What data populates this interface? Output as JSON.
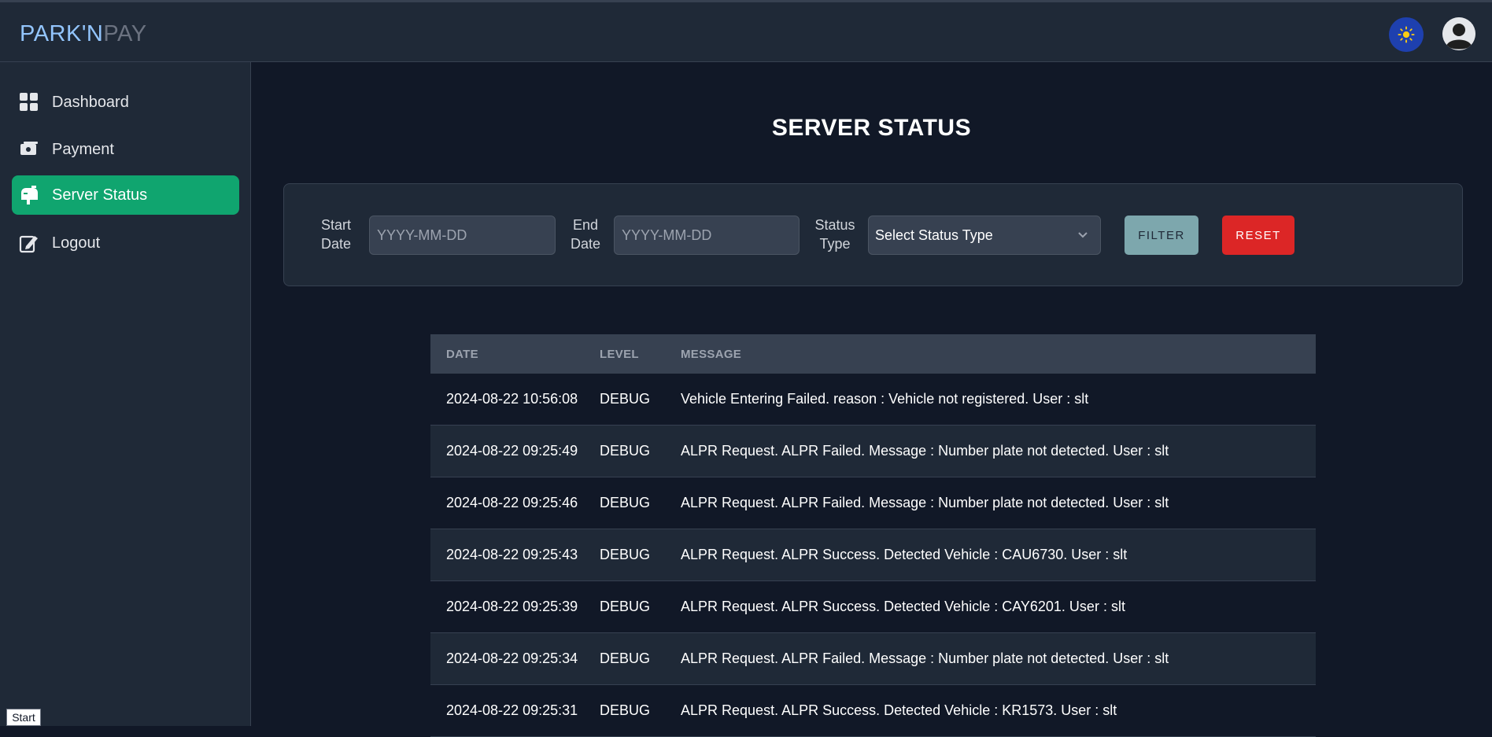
{
  "app": {
    "brand_part1": "PARK'N",
    "brand_part2": "PAY"
  },
  "header": {
    "theme_icon": "sun-icon",
    "avatar_icon": "user-avatar-icon"
  },
  "sidebar": {
    "items": [
      {
        "label": "Dashboard",
        "icon": "dashboard-grid-icon",
        "active": false
      },
      {
        "label": "Payment",
        "icon": "payment-icon",
        "active": false
      },
      {
        "label": "Server Status",
        "icon": "mailbox-icon",
        "active": true
      },
      {
        "label": "Logout",
        "icon": "edit-note-icon",
        "active": false
      }
    ]
  },
  "page": {
    "title": "SERVER STATUS"
  },
  "filters": {
    "start_label_1": "Start",
    "start_label_2": "Date",
    "start_placeholder": "YYYY-MM-DD",
    "end_label_1": "End",
    "end_label_2": "Date",
    "end_placeholder": "YYYY-MM-DD",
    "status_label_1": "Status",
    "status_label_2": "Type",
    "status_selected": "Select Status Type",
    "filter_button": "FILTER",
    "reset_button": "RESET"
  },
  "table": {
    "columns": [
      "DATE",
      "LEVEL",
      "MESSAGE"
    ],
    "rows": [
      {
        "date": "2024-08-22 10:56:08",
        "level": "DEBUG",
        "message": "Vehicle Entering Failed. reason : Vehicle not registered. User : slt"
      },
      {
        "date": "2024-08-22 09:25:49",
        "level": "DEBUG",
        "message": "ALPR Request. ALPR Failed. Message : Number plate not detected. User : slt"
      },
      {
        "date": "2024-08-22 09:25:46",
        "level": "DEBUG",
        "message": "ALPR Request. ALPR Failed. Message : Number plate not detected. User : slt"
      },
      {
        "date": "2024-08-22 09:25:43",
        "level": "DEBUG",
        "message": "ALPR Request. ALPR Success. Detected Vehicle : CAU6730. User : slt"
      },
      {
        "date": "2024-08-22 09:25:39",
        "level": "DEBUG",
        "message": "ALPR Request. ALPR Success. Detected Vehicle : CAY6201. User : slt"
      },
      {
        "date": "2024-08-22 09:25:34",
        "level": "DEBUG",
        "message": "ALPR Request. ALPR Failed. Message : Number plate not detected. User : slt"
      },
      {
        "date": "2024-08-22 09:25:31",
        "level": "DEBUG",
        "message": "ALPR Request. ALPR Success. Detected Vehicle : KR1573. User : slt"
      }
    ]
  },
  "taskbar": {
    "start_label": "Start"
  }
}
